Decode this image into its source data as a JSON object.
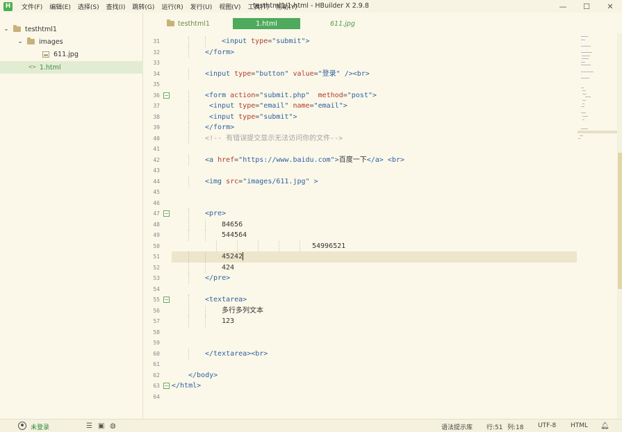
{
  "window": {
    "title": "testhtml1/1.html - HBuilder X 2.9.8",
    "logo": "H",
    "minimize_icon": "—",
    "maximize_icon": "☐",
    "close_icon": "✕"
  },
  "menu": [
    "文件(F)",
    "编辑(E)",
    "选择(S)",
    "查找(I)",
    "跳转(G)",
    "运行(R)",
    "发行(U)",
    "视图(V)",
    "工具(T)",
    "帮助(Y)"
  ],
  "sidebar": {
    "items": [
      {
        "label": "testhtml1",
        "type": "project",
        "expanded": true
      },
      {
        "label": "images",
        "type": "folder",
        "expanded": true
      },
      {
        "label": "611.jpg",
        "type": "image"
      },
      {
        "label": "1.html",
        "type": "html",
        "selected": true
      }
    ]
  },
  "tabs": [
    {
      "label": "testhtml1",
      "type": "project"
    },
    {
      "label": "1.html",
      "type": "file",
      "active": true
    },
    {
      "label": "611.jpg",
      "type": "image"
    }
  ],
  "editor": {
    "current_line": 51,
    "lines": [
      {
        "n": 31,
        "indent": 3,
        "tokens": [
          [
            "tag",
            "<input "
          ],
          [
            "attr",
            "type"
          ],
          [
            "eq",
            "="
          ],
          [
            "str",
            "\"submit\""
          ],
          [
            "tag",
            ">"
          ]
        ]
      },
      {
        "n": 32,
        "indent": 2,
        "tokens": [
          [
            "tag",
            "</form>"
          ]
        ]
      },
      {
        "n": 33,
        "indent": 0,
        "tokens": []
      },
      {
        "n": 34,
        "indent": 2,
        "tokens": [
          [
            "tag",
            "<input "
          ],
          [
            "attr",
            "type"
          ],
          [
            "eq",
            "="
          ],
          [
            "str",
            "\"button\""
          ],
          [
            "tag",
            " "
          ],
          [
            "attr",
            "value"
          ],
          [
            "eq",
            "="
          ],
          [
            "str",
            "\"登录\""
          ],
          [
            "tag",
            " /><br>"
          ]
        ]
      },
      {
        "n": 35,
        "indent": 0,
        "tokens": []
      },
      {
        "n": 36,
        "indent": 2,
        "fold": true,
        "tokens": [
          [
            "tag",
            "<form "
          ],
          [
            "attr",
            "action"
          ],
          [
            "eq",
            "="
          ],
          [
            "str",
            "\"submit.php\""
          ],
          [
            "tag",
            "  "
          ],
          [
            "attr",
            "method"
          ],
          [
            "eq",
            "="
          ],
          [
            "str",
            "\"post\""
          ],
          [
            "tag",
            ">"
          ]
        ]
      },
      {
        "n": 37,
        "indent": 2,
        "extra": "  ",
        "tokens": [
          [
            "tag",
            "<input "
          ],
          [
            "attr",
            "type"
          ],
          [
            "eq",
            "="
          ],
          [
            "str",
            "\"email\""
          ],
          [
            "tag",
            " "
          ],
          [
            "attr",
            "name"
          ],
          [
            "eq",
            "="
          ],
          [
            "str",
            "\"email\""
          ],
          [
            "tag",
            ">"
          ]
        ]
      },
      {
        "n": 38,
        "indent": 2,
        "extra": "  ",
        "tokens": [
          [
            "tag",
            "<input "
          ],
          [
            "attr",
            "type"
          ],
          [
            "eq",
            "="
          ],
          [
            "str",
            "\"submit\""
          ],
          [
            "tag",
            ">"
          ]
        ]
      },
      {
        "n": 39,
        "indent": 2,
        "tokens": [
          [
            "tag",
            "</form>"
          ]
        ]
      },
      {
        "n": 40,
        "indent": 2,
        "tokens": [
          [
            "cmt",
            "<!-- 有错误提交显示无法访问你的文件-->"
          ]
        ]
      },
      {
        "n": 41,
        "indent": 0,
        "tokens": []
      },
      {
        "n": 42,
        "indent": 2,
        "tokens": [
          [
            "tag",
            "<a "
          ],
          [
            "attr",
            "href"
          ],
          [
            "eq",
            "="
          ],
          [
            "str",
            "\"https://www.baidu.com\""
          ],
          [
            "tag",
            ">"
          ],
          [
            "txt",
            "百度一下"
          ],
          [
            "tag",
            "</a> <br>"
          ]
        ]
      },
      {
        "n": 43,
        "indent": 0,
        "tokens": []
      },
      {
        "n": 44,
        "indent": 2,
        "tokens": [
          [
            "tag",
            "<img "
          ],
          [
            "attr",
            "src"
          ],
          [
            "eq",
            "="
          ],
          [
            "str",
            "\"images/611.jpg\""
          ],
          [
            "tag",
            " >"
          ]
        ]
      },
      {
        "n": 45,
        "indent": 0,
        "tokens": []
      },
      {
        "n": 46,
        "indent": 0,
        "tokens": []
      },
      {
        "n": 47,
        "indent": 2,
        "fold": true,
        "tokens": [
          [
            "tag",
            "<pre>"
          ]
        ]
      },
      {
        "n": 48,
        "indent": 3,
        "tokens": [
          [
            "txt",
            "84656"
          ]
        ]
      },
      {
        "n": 49,
        "indent": 3,
        "tokens": [
          [
            "txt",
            "544564"
          ]
        ]
      },
      {
        "n": 50,
        "indent": 0,
        "pad": 202,
        "tokens": [
          [
            "txt",
            "54996521"
          ]
        ]
      },
      {
        "n": 51,
        "indent": 3,
        "cursor": true,
        "tokens": [
          [
            "txt",
            "45242"
          ]
        ]
      },
      {
        "n": 52,
        "indent": 3,
        "tokens": [
          [
            "txt",
            "424"
          ]
        ]
      },
      {
        "n": 53,
        "indent": 2,
        "tokens": [
          [
            "tag",
            "</pre>"
          ]
        ]
      },
      {
        "n": 54,
        "indent": 0,
        "tokens": []
      },
      {
        "n": 55,
        "indent": 2,
        "fold": true,
        "tokens": [
          [
            "tag",
            "<textarea>"
          ]
        ]
      },
      {
        "n": 56,
        "indent": 3,
        "tokens": [
          [
            "txt",
            "多行多列文本"
          ]
        ]
      },
      {
        "n": 57,
        "indent": 3,
        "tokens": [
          [
            "txt",
            "123"
          ]
        ]
      },
      {
        "n": 58,
        "indent": 0,
        "tokens": []
      },
      {
        "n": 59,
        "indent": 0,
        "tokens": []
      },
      {
        "n": 60,
        "indent": 2,
        "tokens": [
          [
            "tag",
            "</textarea><br>"
          ]
        ]
      },
      {
        "n": 61,
        "indent": 0,
        "tokens": []
      },
      {
        "n": 62,
        "indent": 1,
        "tokens": [
          [
            "tag",
            "</body>"
          ]
        ]
      },
      {
        "n": 63,
        "indent": 0,
        "fold": true,
        "tokens": [
          [
            "tag",
            "</html>"
          ]
        ]
      },
      {
        "n": 64,
        "indent": 0,
        "tokens": []
      }
    ]
  },
  "statusbar": {
    "login": "未登录",
    "syntax_hint": "语法提示库",
    "position_line": "行:51",
    "position_col": "列:18",
    "encoding": "UTF-8",
    "language": "HTML"
  },
  "colors": {
    "accent": "#4eaa5c",
    "background": "#fbf8e9",
    "current_line": "#ede5cc",
    "tag": "#2c5fa0",
    "attribute": "#b03a2e",
    "comment": "#a3a3a3"
  }
}
